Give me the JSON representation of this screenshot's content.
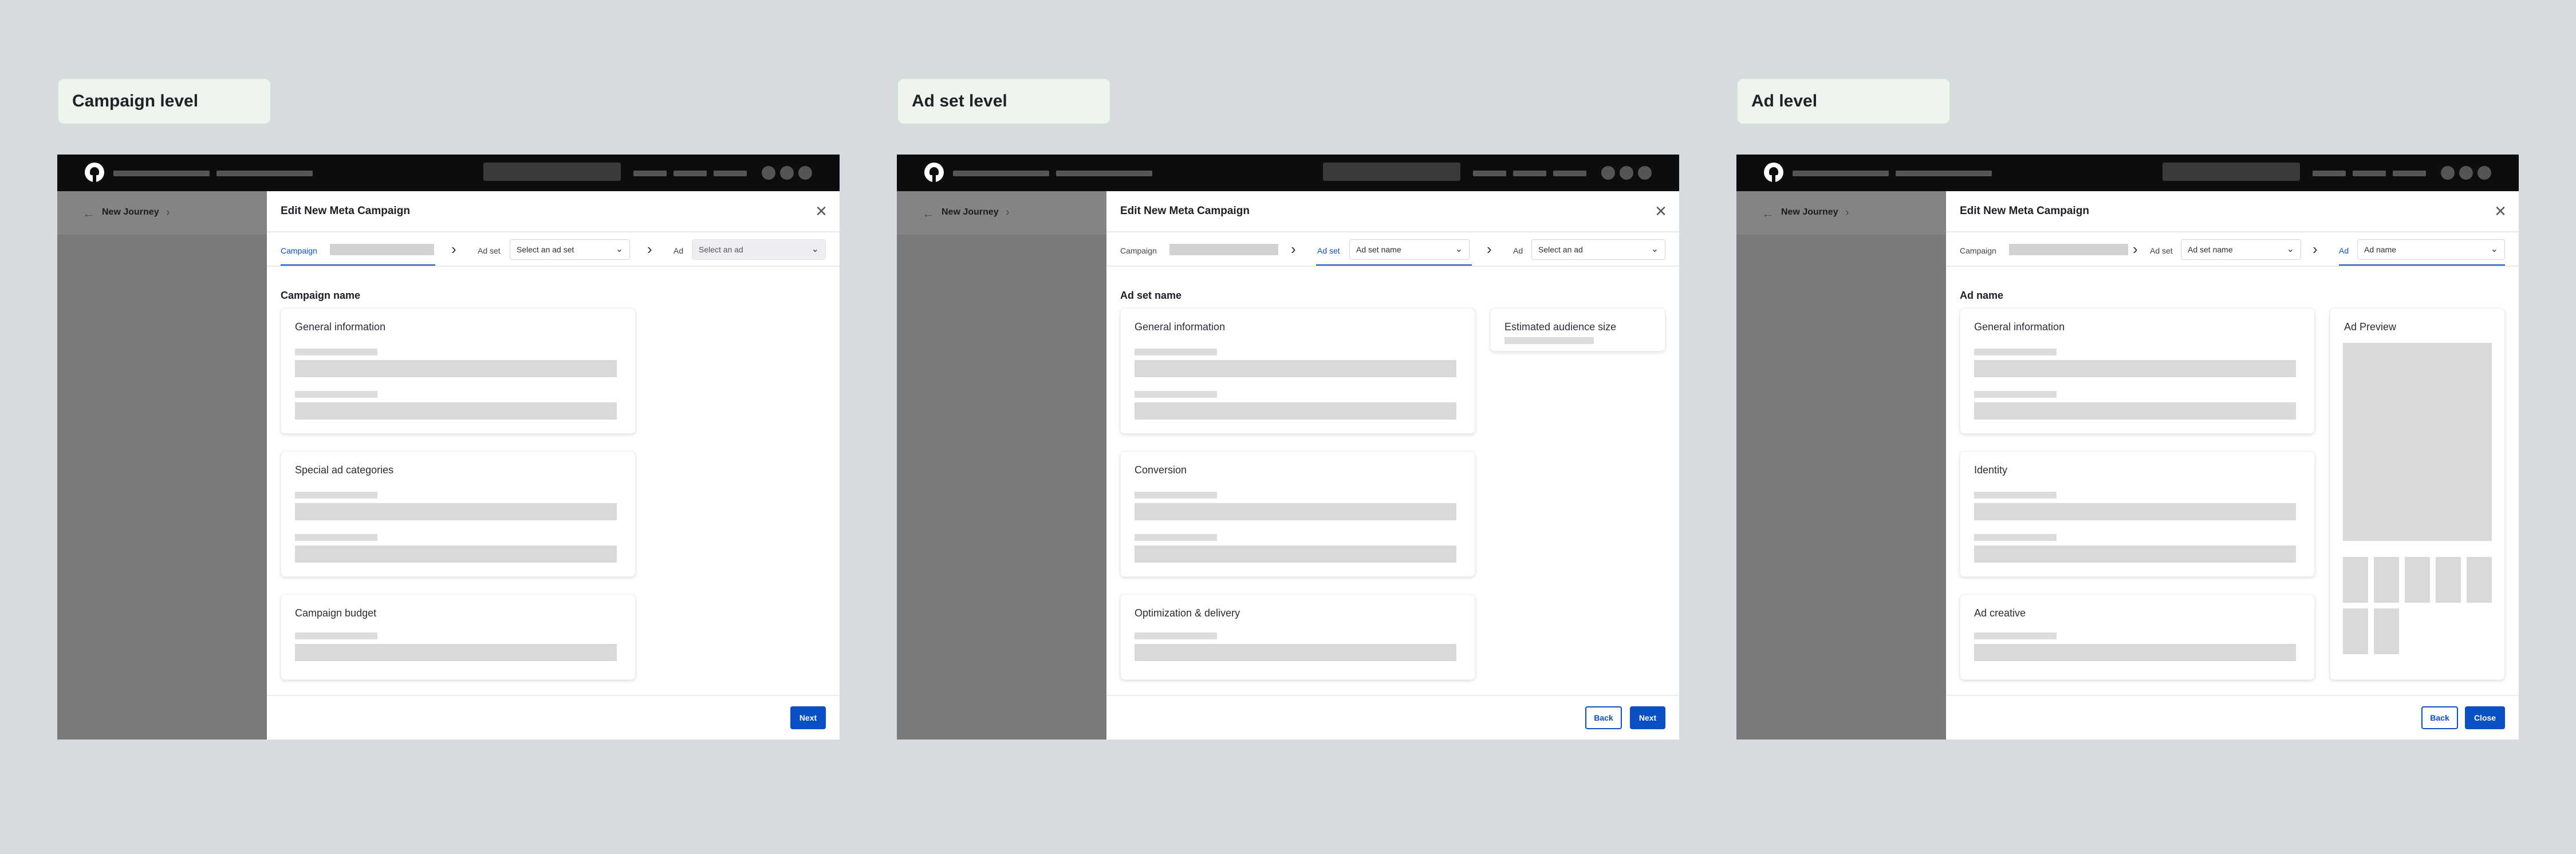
{
  "panels": [
    {
      "level_label": "Campaign level",
      "journey": "New Journey",
      "modal_title": "Edit New Meta Campaign",
      "steps": {
        "campaign": "Campaign",
        "adset": "Ad set",
        "adset_value": "Select an ad set",
        "ad": "Ad",
        "ad_value": "Select an ad"
      },
      "section_title": "Campaign name",
      "cards": [
        "General information",
        "Special ad categories",
        "Campaign budget"
      ],
      "next": "Next"
    },
    {
      "level_label": "Ad set level",
      "journey": "New Journey",
      "modal_title": "Edit New Meta Campaign",
      "steps": {
        "campaign": "Campaign",
        "adset": "Ad set",
        "adset_value": "Ad set name",
        "ad": "Ad",
        "ad_value": "Select an ad"
      },
      "section_title": "Ad set name",
      "cards": [
        "General information",
        "Conversion",
        "Optimization & delivery"
      ],
      "side_card": "Estimated audience size",
      "back": "Back",
      "next": "Next"
    },
    {
      "level_label": "Ad level",
      "journey": "New Journey",
      "modal_title": "Edit New Meta Campaign",
      "steps": {
        "campaign": "Campaign",
        "adset": "Ad set",
        "adset_value": "Ad set name",
        "ad": "Ad",
        "ad_value": "Ad name"
      },
      "section_title": "Ad name",
      "cards": [
        "General information",
        "Identity",
        "Ad creative"
      ],
      "side_card": "Ad Preview",
      "back": "Back",
      "close": "Close"
    }
  ],
  "icons": {
    "logo": "brand-logo",
    "back": "back-arrow-icon",
    "breadcrumb": "chevron-right-icon",
    "close": "close-icon",
    "dropdown": "chevron-down-icon"
  },
  "colors": {
    "accent": "#0b4fc4",
    "topbar": "#0d0d0d",
    "canvas": "#d7dbdf",
    "level_chip": "#eef5ef",
    "skeleton": "#d9d9d9"
  }
}
